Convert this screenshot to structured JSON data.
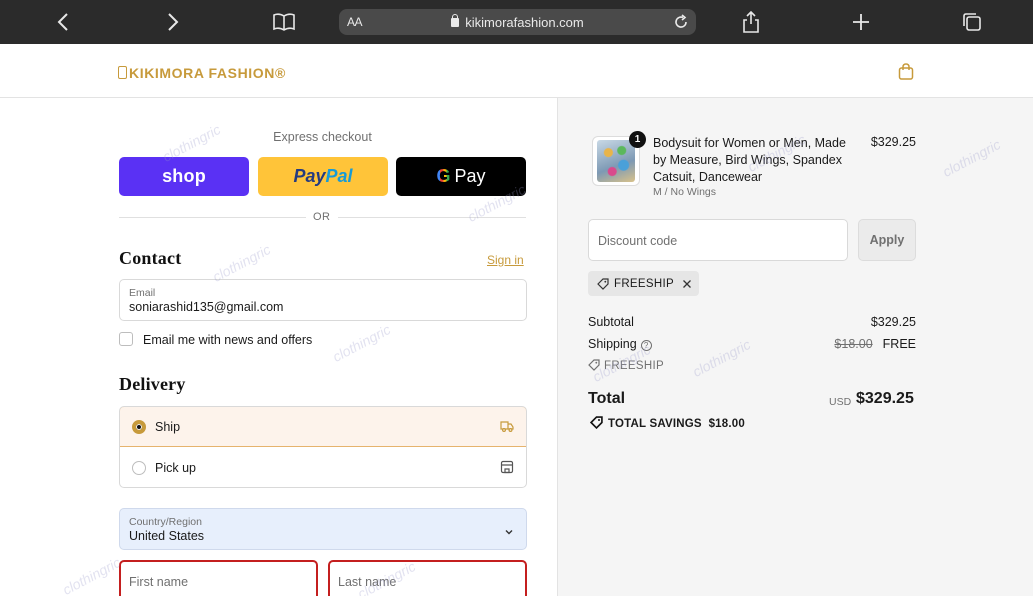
{
  "browser": {
    "text_size_label": "AA",
    "url": "kikimorafashion.com",
    "icons": [
      "back-icon",
      "forward-icon",
      "bookmarks-icon",
      "lock-icon",
      "reload-icon",
      "share-icon",
      "new-tab-icon",
      "tabs-icon"
    ]
  },
  "header": {
    "logo_text": "KIKIMORA FASHION®",
    "accent_color": "#c79a3b"
  },
  "checkout": {
    "express_title": "Express checkout",
    "shop_label": "shop",
    "paypal_label_1": "Pay",
    "paypal_label_2": "Pal",
    "gpay_g": "G",
    "gpay_label": "Pay",
    "or_label": "OR",
    "contact": {
      "title": "Contact",
      "signin": "Sign in",
      "email_label": "Email",
      "email_value": "soniarashid135@gmail.com",
      "news_label": "Email me with news and offers"
    },
    "delivery": {
      "title": "Delivery",
      "options": [
        {
          "label": "Ship",
          "selected": true
        },
        {
          "label": "Pick up",
          "selected": false
        }
      ],
      "country_label": "Country/Region",
      "country_value": "United States",
      "first_name_placeholder": "First name",
      "last_name_placeholder": "Last name"
    }
  },
  "summary": {
    "item": {
      "quantity": "1",
      "title": "Bodysuit for Women or Men, Made by Measure, Bird Wings, Spandex Catsuit, Dancewear",
      "variant": "M / No Wings",
      "price": "$329.25"
    },
    "discount_placeholder": "Discount code",
    "apply_label": "Apply",
    "applied_code": "FREESHIP",
    "subtotal_label": "Subtotal",
    "subtotal_value": "$329.25",
    "shipping_label": "Shipping",
    "shipping_help": "?",
    "shipping_original": "$18.00",
    "shipping_value": "FREE",
    "shipping_code": "FREESHIP",
    "total_label": "Total",
    "total_currency": "USD",
    "total_value": "$329.25",
    "savings_label": "TOTAL SAVINGS",
    "savings_value": "$18.00"
  },
  "watermark_text": "clothingric"
}
